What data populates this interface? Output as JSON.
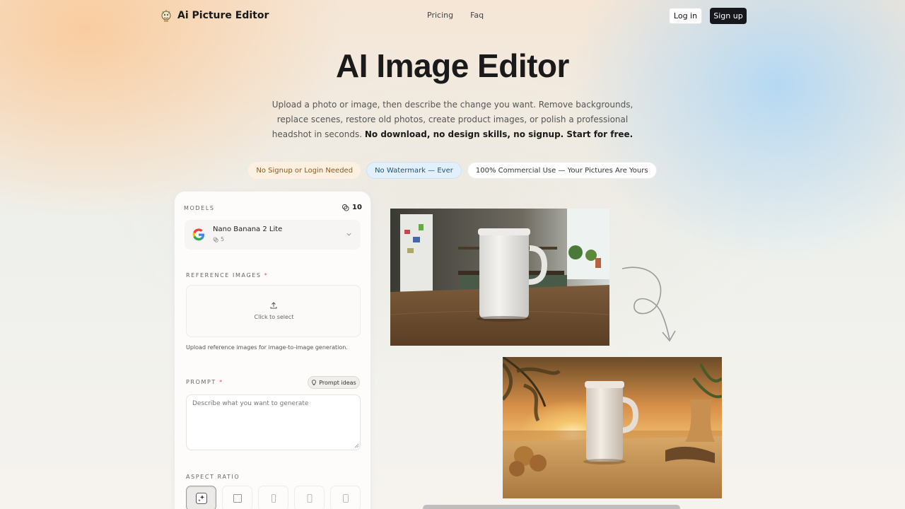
{
  "nav": {
    "brand": "Ai Picture Editor",
    "links": [
      "Pricing",
      "Faq"
    ],
    "login": "Log in",
    "signup": "Sign up"
  },
  "hero": {
    "title": "AI Image Editor",
    "subtitle": "Upload a photo or image, then describe the change you want. Remove backgrounds, replace scenes, restore old photos, create product images, or polish a professional headshot in seconds.",
    "subtitle_bold": "No download, no design skills, no signup. Start for free."
  },
  "pills": [
    "No Signup or Login Needed",
    "No Watermark — Ever",
    "100% Commercial Use — Your Pictures Are Yours"
  ],
  "panel": {
    "models_label": "MODELS",
    "credits": "10",
    "model": {
      "name": "Nano Banana 2 Lite",
      "cost": "5",
      "icon": "google-logo"
    },
    "reference_label": "REFERENCE IMAGES",
    "upload_text": "Click to select",
    "upload_hint": "Upload reference images for image-to-image generation.",
    "prompt_label": "PROMPT",
    "prompt_ideas": "Prompt ideas",
    "prompt_placeholder": "Describe what you want to generate",
    "aspect_label": "ASPECT RATIO",
    "required_mark": "*"
  },
  "colors": {
    "accent": "#16181d",
    "required": "#e05050"
  }
}
